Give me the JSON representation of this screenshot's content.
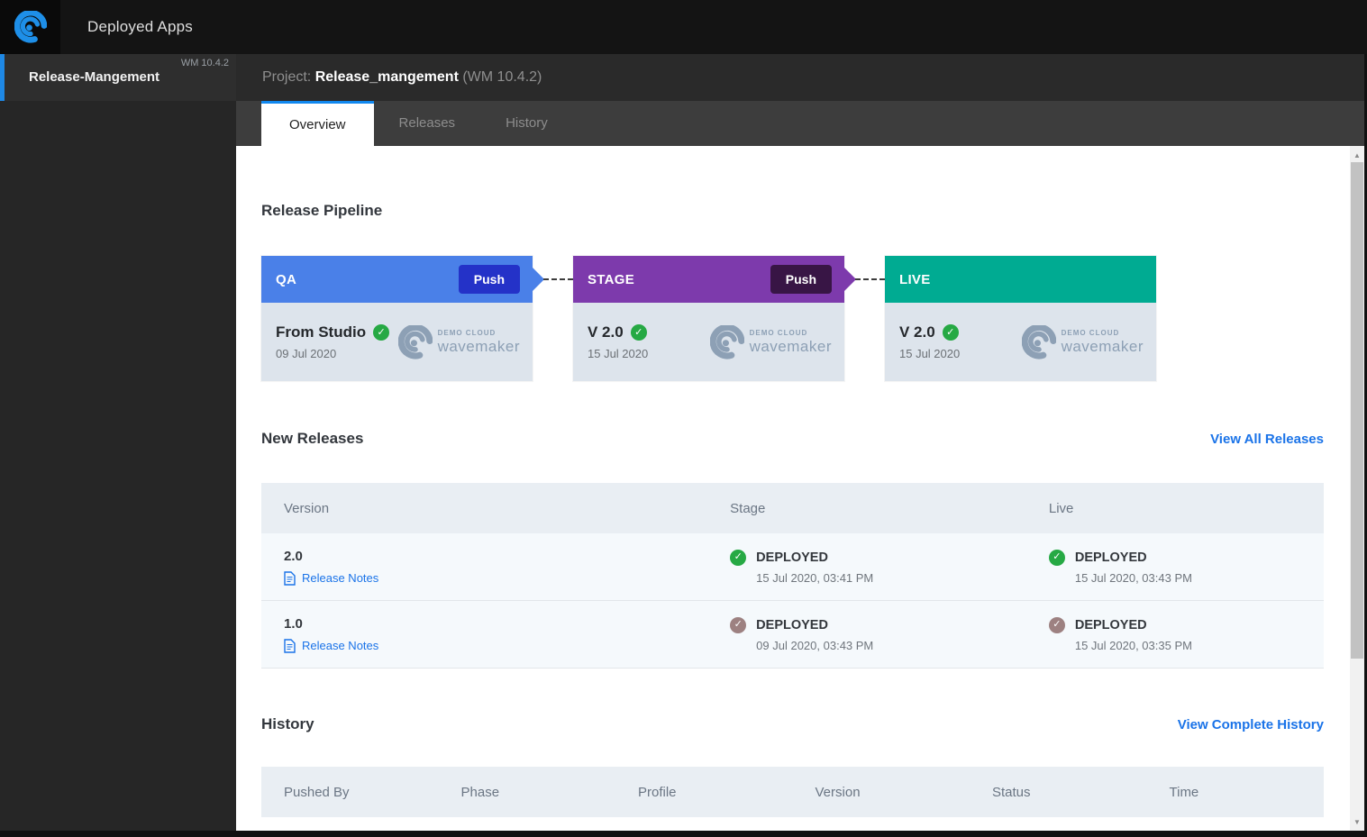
{
  "topbar": {
    "title": "Deployed Apps"
  },
  "sidebar": {
    "project": {
      "name": "Release-Mangement",
      "version": "WM 10.4.2"
    }
  },
  "header": {
    "label": "Project:",
    "project_name": "Release_mangement",
    "version": "(WM 10.4.2)"
  },
  "tabs": [
    {
      "label": "Overview",
      "active": true
    },
    {
      "label": "Releases",
      "active": false
    },
    {
      "label": "History",
      "active": false
    }
  ],
  "pipeline": {
    "title": "Release Pipeline",
    "logo": {
      "line1": "DEMO CLOUD",
      "line2": "wavemaker"
    },
    "stages": [
      {
        "name": "QA",
        "color": "#4a80e8",
        "push_label": "Push",
        "push_color": "#2432c8",
        "version": "From Studio",
        "date": "09 Jul 2020"
      },
      {
        "name": "STAGE",
        "color": "#7d3aac",
        "push_label": "Push",
        "push_color": "#381545",
        "version": "V 2.0",
        "date": "15 Jul 2020"
      },
      {
        "name": "LIVE",
        "color": "#00ab92",
        "version": "V 2.0",
        "date": "15 Jul 2020"
      }
    ]
  },
  "new_releases": {
    "title": "New Releases",
    "view_all": "View All Releases",
    "columns": [
      "Version",
      "Stage",
      "Live"
    ],
    "rows": [
      {
        "version": "2.0",
        "notes_label": "Release Notes",
        "stage": {
          "status": "DEPLOYED",
          "time": "15 Jul 2020, 03:41 PM",
          "check_color": "#26a944"
        },
        "live": {
          "status": "DEPLOYED",
          "time": "15 Jul 2020, 03:43 PM",
          "check_color": "#26a944"
        }
      },
      {
        "version": "1.0",
        "notes_label": "Release Notes",
        "stage": {
          "status": "DEPLOYED",
          "time": "09 Jul 2020, 03:43 PM",
          "check_color": "#9d8181"
        },
        "live": {
          "status": "DEPLOYED",
          "time": "15 Jul 2020, 03:35 PM",
          "check_color": "#9d8181"
        }
      }
    ]
  },
  "history": {
    "title": "History",
    "view_all": "View Complete History",
    "columns": [
      "Pushed By",
      "Phase",
      "Profile",
      "Version",
      "Status",
      "Time"
    ]
  },
  "theme": {
    "accent_blue": "#1e88e5",
    "link_blue": "#1a73e8",
    "success_green": "#26a944",
    "stale_mauve": "#9d8181",
    "card_body": "#dde4ec"
  }
}
